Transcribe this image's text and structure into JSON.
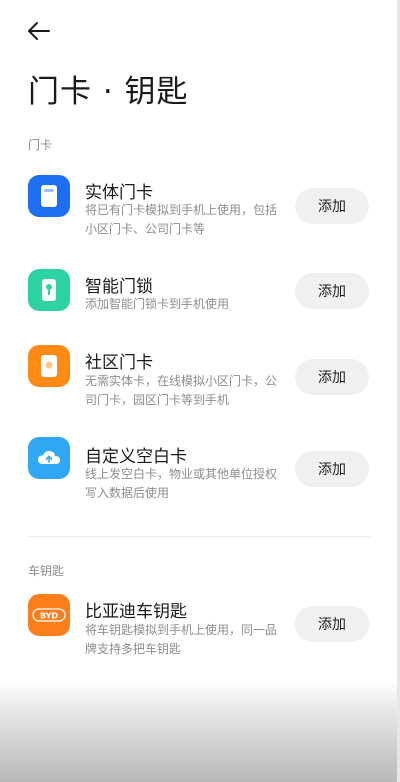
{
  "header": {
    "back_icon": "arrow-left-icon",
    "title": "门卡 · 钥匙"
  },
  "sections": {
    "door_cards": {
      "label": "门卡",
      "items": [
        {
          "icon": "card-icon",
          "color": "#1e6ef2",
          "title": "实体门卡",
          "desc": "将已有门卡模拟到手机上使用，包括小区门卡、公司门卡等",
          "button": "添加"
        },
        {
          "icon": "smart-lock-icon",
          "color": "#2ed3a4",
          "title": "智能门锁",
          "desc": "添加智能门锁卡到手机使用",
          "button": "添加"
        },
        {
          "icon": "community-card-icon",
          "color": "#ff8a14",
          "title": "社区门卡",
          "desc": "无需实体卡，在线模拟小区门卡，公司门卡，园区门卡等到手机",
          "button": "添加"
        },
        {
          "icon": "cloud-card-icon",
          "color": "#2fa7f5",
          "title": "自定义空白卡",
          "desc": "线上发空白卡，物业或其他单位授权写入数据后使用",
          "button": "添加"
        }
      ]
    },
    "car_keys": {
      "label": "车钥匙",
      "items": [
        {
          "icon": "byd-logo-icon",
          "logo_text": "BYD",
          "color": "#ff7e1c",
          "title": "比亚迪车钥匙",
          "desc": "将车钥匙模拟到手机上使用，同一品牌支持多把车钥匙",
          "button": "添加"
        }
      ]
    }
  }
}
